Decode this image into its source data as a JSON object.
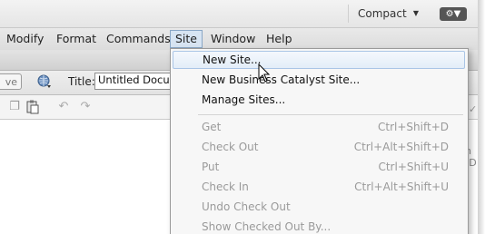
{
  "workspace": {
    "label": "Compact",
    "arrow_icon": "chevron-down-icon",
    "settings_icon": "gear-icon"
  },
  "menubar": {
    "items": [
      {
        "label": "Modify"
      },
      {
        "label": "Format"
      },
      {
        "label": "Commands"
      },
      {
        "label": "Site"
      },
      {
        "label": "Window"
      },
      {
        "label": "Help"
      }
    ],
    "active": "Site"
  },
  "toolbar": {
    "stub_label": "ve",
    "title_label": "Title:",
    "title_value": "Untitled Docume"
  },
  "right_edge": {
    "text": "n (D"
  },
  "site_menu": {
    "items": [
      {
        "label": "New Site...",
        "shortcut": "",
        "enabled": true,
        "hover": true
      },
      {
        "label": "New Business Catalyst Site...",
        "shortcut": "",
        "enabled": true
      },
      {
        "label": "Manage Sites...",
        "shortcut": "",
        "enabled": true
      },
      {
        "label": "Get",
        "shortcut": "Ctrl+Shift+D",
        "enabled": false
      },
      {
        "label": "Check Out",
        "shortcut": "Ctrl+Alt+Shift+D",
        "enabled": false
      },
      {
        "label": "Put",
        "shortcut": "Ctrl+Shift+U",
        "enabled": false
      },
      {
        "label": "Check In",
        "shortcut": "Ctrl+Alt+Shift+U",
        "enabled": false
      },
      {
        "label": "Undo Check Out",
        "shortcut": "",
        "enabled": false
      },
      {
        "label": "Show Checked Out By...",
        "shortcut": "",
        "enabled": false
      }
    ]
  },
  "colors": {
    "menu_active_bg": "#d7e4f2",
    "menu_hover_border": "#aac5e6",
    "disabled_text": "#9a9a9a"
  }
}
